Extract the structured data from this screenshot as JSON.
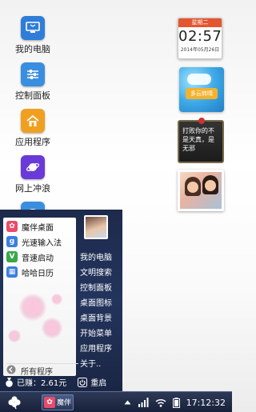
{
  "desktop": {
    "icons": [
      {
        "label": "我的电脑",
        "icon": "computer-icon",
        "color": "#2f7dd8"
      },
      {
        "label": "控制面板",
        "icon": "sliders-icon",
        "color": "#3a8ee0"
      },
      {
        "label": "应用程序",
        "icon": "home-icon",
        "color": "#f0a020"
      },
      {
        "label": "网上冲浪",
        "icon": "planet-icon",
        "color": "#6a3ad8"
      },
      {
        "label": "",
        "icon": "chat-icon",
        "color": "#3a8ee0"
      }
    ]
  },
  "widgets": {
    "calendar": {
      "weekday": "星期二",
      "time": "02:57",
      "date": "2014年05月26日"
    },
    "weather": {
      "badge": "多云转晴"
    },
    "note": {
      "text": "打败你的不是天真，是无邪"
    }
  },
  "start_menu": {
    "left_items": [
      {
        "label": "魔伴桌面",
        "icon": "flower-icon",
        "color": "#e94b6a"
      },
      {
        "label": "光速输入法",
        "icon": "g-icon",
        "color": "#3b7ee0"
      },
      {
        "label": "音速启动",
        "icon": "v-icon",
        "color": "#3aa84a"
      },
      {
        "label": "哈哈日历",
        "icon": "calendar-icon",
        "color": "#3b7ee0"
      }
    ],
    "all_programs": "所有程序",
    "right_items": [
      "我的电脑",
      "文明搜索",
      "控制面板",
      "桌面图标",
      "桌面背景",
      "开始菜单",
      "应用程序",
      "关于.."
    ],
    "earned": "已赚：2.61元",
    "restart": "重启"
  },
  "taskbar": {
    "app_label": "魔伴",
    "clock": "17:12:32"
  },
  "colors": {
    "taskbar": "#18213a",
    "menu": "#1d2a4c",
    "calendar_accent": "#e4572e"
  }
}
